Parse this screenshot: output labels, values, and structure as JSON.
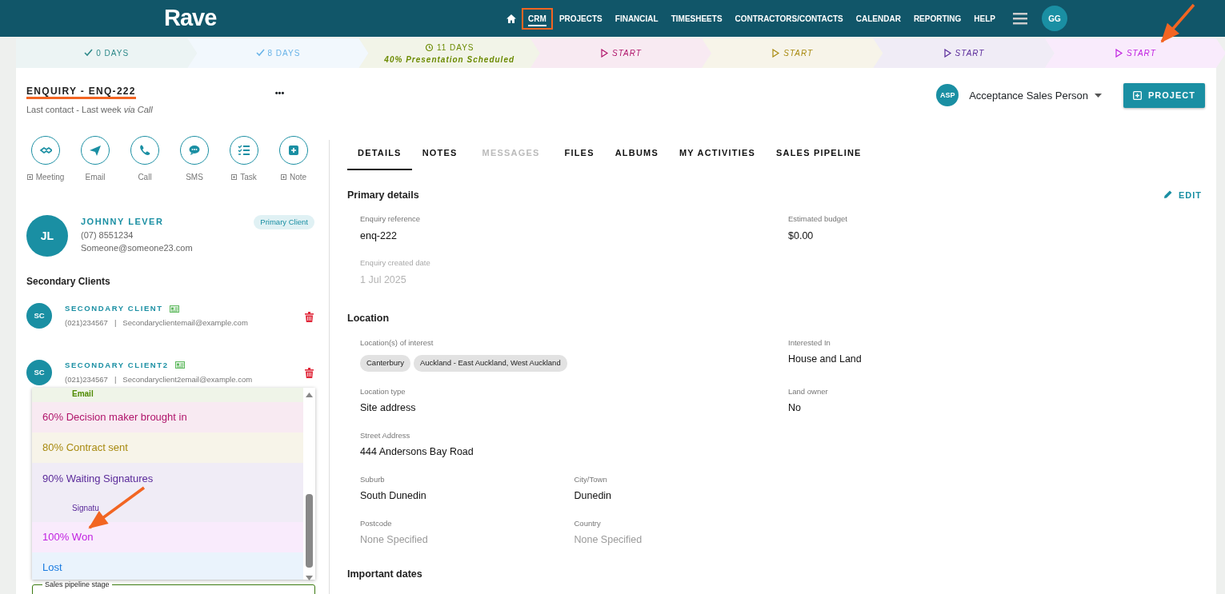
{
  "navbar": {
    "logo": "Rave",
    "items": [
      {
        "label": "CRM",
        "selected": true,
        "highlighted": true
      },
      {
        "label": "PROJECTS",
        "selected": false,
        "highlighted": false
      },
      {
        "label": "FINANCIAL",
        "selected": false,
        "highlighted": false
      },
      {
        "label": "TIMESHEETS",
        "selected": false,
        "highlighted": false
      },
      {
        "label": "CONTRACTORS/CONTACTS",
        "selected": false,
        "highlighted": false
      },
      {
        "label": "CALENDAR",
        "selected": false,
        "highlighted": false
      },
      {
        "label": "REPORTING",
        "selected": false,
        "highlighted": false
      },
      {
        "label": "HELP",
        "selected": false,
        "highlighted": false
      }
    ],
    "user_initials": "GG"
  },
  "stages": [
    {
      "kind": "done",
      "label": "0 DAYS",
      "color": "#2f8a8a"
    },
    {
      "kind": "done",
      "label": "8 DAYS",
      "color": "#6ab4e8"
    },
    {
      "kind": "current",
      "label": "11 DAYS",
      "note": "40% Presentation Scheduled",
      "color": "#6b8a00"
    },
    {
      "kind": "pending",
      "label": "START",
      "color": "#b0156b"
    },
    {
      "kind": "pending",
      "label": "START",
      "color": "#a88a10"
    },
    {
      "kind": "pending",
      "label": "START",
      "color": "#5a2a9a"
    },
    {
      "kind": "pending",
      "label": "START",
      "color": "#c020e0"
    }
  ],
  "header": {
    "title": "ENQUIRY - ENQ-222",
    "title_highlighted": true,
    "subtitle": "Last contact - Last week *via Call*",
    "more": "•••",
    "assignee_initials": "ASP",
    "assignee": "Acceptance Sales Person",
    "project_button": "PROJECT"
  },
  "actions": [
    {
      "kind": "meeting",
      "label": "Meeting",
      "addable": true
    },
    {
      "kind": "email",
      "label": "Email",
      "addable": false
    },
    {
      "kind": "call",
      "label": "Call",
      "addable": false
    },
    {
      "kind": "sms",
      "label": "SMS",
      "addable": false
    },
    {
      "kind": "task",
      "label": "Task",
      "addable": true
    },
    {
      "kind": "note",
      "label": "Note",
      "addable": true
    }
  ],
  "primary_client": {
    "initials": "JL",
    "name": "JOHNNY LEVER",
    "phone": "(07) 8551234",
    "email": "Someone@someone23.com",
    "badge": "Primary Client"
  },
  "secondary_heading": "Secondary Clients",
  "secondary_clients": [
    {
      "initials": "SC",
      "name": "SECONDARY CLIENT",
      "phone": "(021)234567",
      "separator": "|",
      "email": "Secondaryclientemail@example.com"
    },
    {
      "initials": "SC",
      "name": "SECONDARY CLIENT2",
      "phone": "(021)234567",
      "separator": "|",
      "email": "Secondaryclient2email@example.com"
    }
  ],
  "pipeline_dropdown": {
    "options": [
      {
        "note": "Email",
        "color": "#4f8a00",
        "selected": false
      },
      {
        "label": "60% Decision maker brought in",
        "color": "#b0156b",
        "selected": false
      },
      {
        "label": "80% Contract sent",
        "color": "#a88a10",
        "selected": false
      },
      {
        "label": "90% Waiting Signatures",
        "note": "Signatu",
        "color": "#5a2a9a",
        "selected": false
      },
      {
        "label": "100% Won",
        "color": "#c020e0",
        "selected": false
      },
      {
        "label": "Lost",
        "color": "#1a7be0",
        "selected": false
      }
    ],
    "field_label": "Sales pipeline stage"
  },
  "tabs": [
    {
      "label": "DETAILS",
      "selected": true,
      "disabled": false
    },
    {
      "label": "NOTES",
      "selected": false,
      "disabled": false
    },
    {
      "label": "MESSAGES",
      "selected": false,
      "disabled": true
    },
    {
      "label": "FILES",
      "selected": false,
      "disabled": false
    },
    {
      "label": "ALBUMS",
      "selected": false,
      "disabled": false
    },
    {
      "label": "MY ACTIVITIES",
      "selected": false,
      "disabled": false
    },
    {
      "label": "SALES PIPELINE",
      "selected": false,
      "disabled": false
    }
  ],
  "sections": [
    {
      "title": "Primary details",
      "edit": "EDIT",
      "rows": [
        [
          {
            "label": "Enquiry reference",
            "value": "enq-222",
            "disabled": false
          },
          "",
          {
            "label": "Estimated budget",
            "value": "$0.00",
            "disabled": false
          }
        ],
        [
          {
            "label": "Enquiry created date",
            "value": "1 Jul 2025",
            "disabled": true
          }
        ]
      ]
    },
    {
      "title": "Location",
      "rows": [
        [
          {
            "label": "Location(s) of interest",
            "chips": [
              "Canterbury",
              "Auckland - East Auckland, West Auckland"
            ],
            "disabled": false
          },
          "",
          {
            "label": "Interested In",
            "value": "House and Land",
            "disabled": false
          }
        ],
        [
          {
            "label": "Location type",
            "value": "Site address",
            "disabled": false
          },
          "",
          {
            "label": "Land owner",
            "value": "No",
            "disabled": false
          }
        ],
        [
          {
            "label": "Street Address",
            "value": "444 Andersons Bay Road",
            "disabled": false
          }
        ],
        [
          {
            "label": "Suburb",
            "value": "South Dunedin",
            "disabled": false
          },
          {
            "label": "City/Town",
            "value": "Dunedin",
            "disabled": false
          }
        ],
        [
          {
            "label": "Postcode",
            "placeholder": "None Specified",
            "disabled": false
          },
          {
            "label": "Country",
            "placeholder": "None Specified",
            "disabled": false
          }
        ]
      ]
    },
    {
      "title": "Important dates"
    }
  ]
}
